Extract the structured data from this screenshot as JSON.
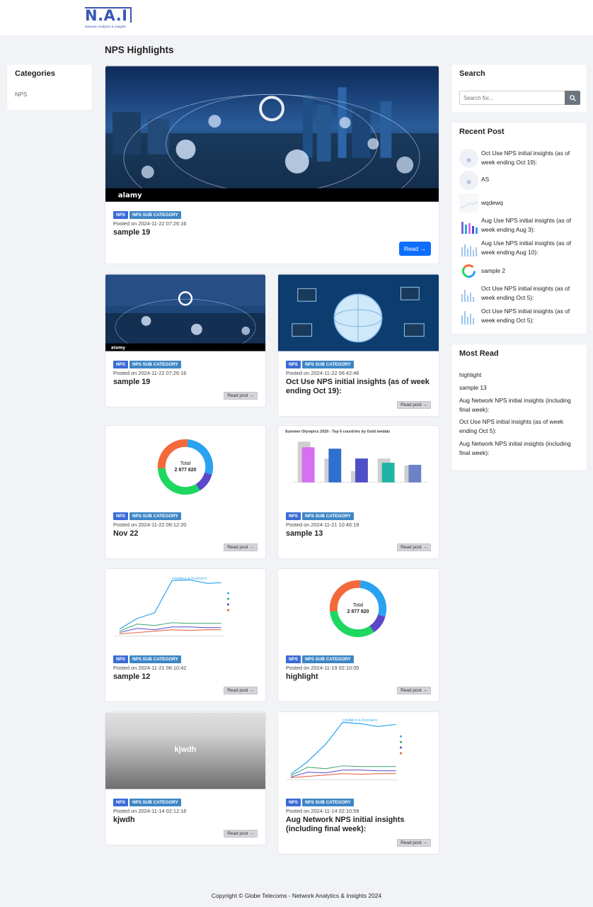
{
  "brand": {
    "logo_text": "N.A.I",
    "logo_subtitle": "Network Analytics & Insights"
  },
  "page": {
    "title": "NPS Highlights"
  },
  "categories": {
    "title": "Categories",
    "items": [
      "NPS"
    ]
  },
  "posts": [
    {
      "tag1": "NPS",
      "tag2": "NPS SUB CATEGORY",
      "posted": "Posted on 2024-11-22 07:26:16",
      "title": "sample 19",
      "read": "Read →"
    },
    {
      "tag1": "NPS",
      "tag2": "NPS SUB CATEGORY",
      "posted": "Posted on 2024-11-22 07:26:16",
      "title": "sample 19",
      "read": "Read post →"
    },
    {
      "tag1": "NPS",
      "tag2": "NPS SUB CATEGORY",
      "posted": "Posted on 2024-11-22 06:42:46",
      "title": "Oct Use NPS initial insights (as of week ending Oct 19):",
      "read": "Read post →"
    },
    {
      "tag1": "NPS",
      "tag2": "NPS SUB CATEGORY",
      "posted": "Posted on 2024-11-22 06:12:20",
      "title": "Nov 22",
      "read": "Read post →"
    },
    {
      "tag1": "NPS",
      "tag2": "NPS SUB CATEGORY",
      "posted": "Posted on 2024-11-21 10:46:19",
      "title": "sample 13",
      "read": "Read post →"
    },
    {
      "tag1": "NPS",
      "tag2": "NPS SUB CATEGORY",
      "posted": "Posted on 2024-11-21 06:10:42",
      "title": "sample 12",
      "read": "Read post →"
    },
    {
      "tag1": "NPS",
      "tag2": "NPS SUB CATEGORY",
      "posted": "Posted on 2024-11-19 02:10:05",
      "title": "highlight",
      "read": "Read post →"
    },
    {
      "tag1": "NPS",
      "tag2": "NPS SUB CATEGORY",
      "posted": "Posted on 2024-11-14 02:12:16",
      "title": "kjwdh",
      "read": "Read post →",
      "thumb_text": "kjwdh"
    },
    {
      "tag1": "NPS",
      "tag2": "NPS SUB CATEGORY",
      "posted": "Posted on 2024-11-14 02:10:59",
      "title": "Aug Network NPS initial insights (including final week):",
      "read": "Read post →"
    }
  ],
  "thumb_text": {
    "alamy": "alamy",
    "donut_total_label": "Total",
    "donut_total_value": "2 877 820",
    "bar_chart_title": "Summer Olympics 2020 - Top 5 countries by Gold medals",
    "line_chart_series": "Installation & Developers"
  },
  "search": {
    "title": "Search",
    "placeholder": "Search for..."
  },
  "recent": {
    "title": "Recent Post",
    "items": [
      "Oct Use NPS initial insights (as of week ending Oct 19):",
      "AS",
      "wqdewq",
      "Aug Use NPS initial insights (as of week ending Aug 3):",
      "Aug Use NPS initial insights (as of week ending Aug 10):",
      "sample 2",
      "Oct Use NPS initial insights (as of week ending Oct 5):",
      "Oct Use NPS initial insights (as of week ending Oct 5):"
    ]
  },
  "most_read": {
    "title": "Most Read",
    "items": [
      "highlight",
      "sample 13",
      "Aug Network NPS initial insights (including final week):",
      "Oct Use NPS initial insights (as of week ending Oct 5):",
      "Aug Network NPS initial insights (including final week):"
    ]
  },
  "footer": {
    "text": "Copyright © Globe Telecoms - Network Analytics & Insights 2024"
  },
  "colors": {
    "primary": "#0d6efd",
    "tag_nps": "#3a6bd6",
    "tag_sub": "#3d86c6",
    "bg": "#f2f3f6"
  }
}
